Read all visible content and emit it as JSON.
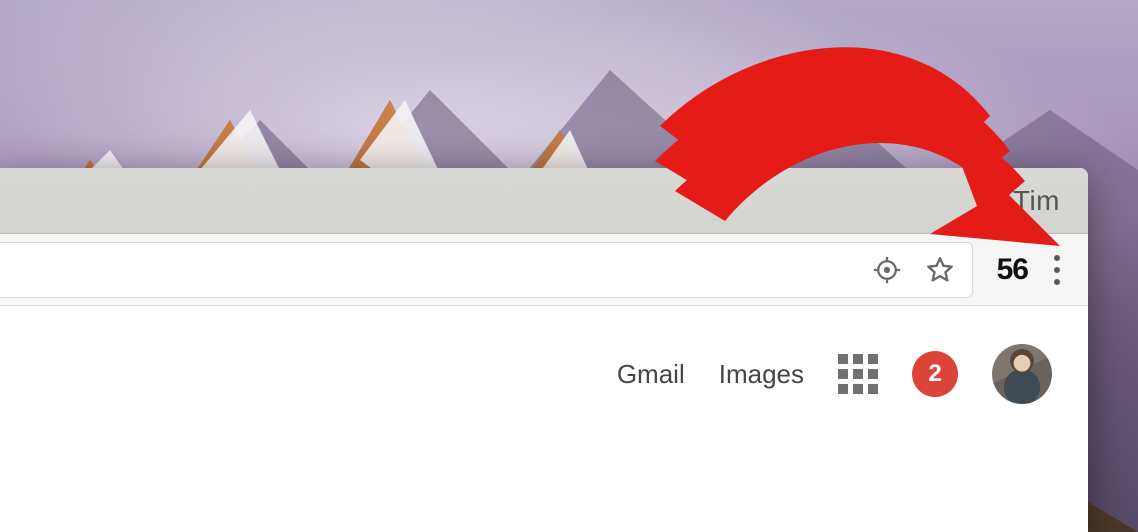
{
  "browser": {
    "profile_name": "Tim",
    "extension_count": "56"
  },
  "page": {
    "links": {
      "gmail": "Gmail",
      "images": "Images"
    },
    "notifications_count": "2"
  },
  "annotation": {
    "arrow_color": "#e41b17"
  }
}
